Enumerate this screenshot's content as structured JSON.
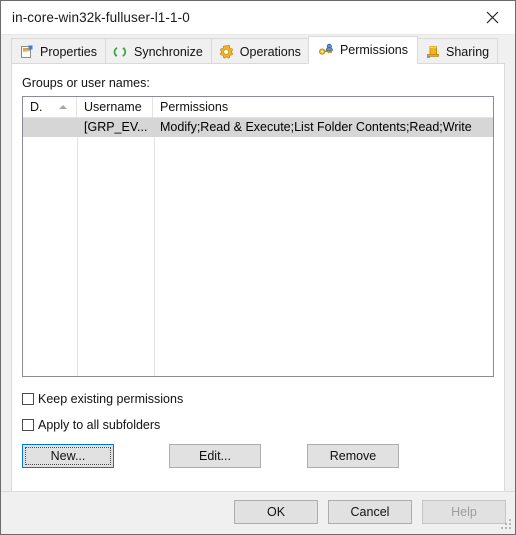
{
  "window": {
    "title": "in-core-win32k-fulluser-l1-1-0",
    "close_icon": "close-icon",
    "resize_grip": "resize-grip"
  },
  "tabs": [
    {
      "label": "Properties",
      "icon": "properties-icon",
      "active": false
    },
    {
      "label": "Synchronize",
      "icon": "synchronize-icon",
      "active": false
    },
    {
      "label": "Operations",
      "icon": "operations-gear-icon",
      "active": false
    },
    {
      "label": "Permissions",
      "icon": "permissions-key-icon",
      "active": true
    },
    {
      "label": "Sharing",
      "icon": "sharing-hand-icon",
      "active": false
    }
  ],
  "main": {
    "groups_label": "Groups or user names:",
    "list": {
      "columns": [
        "D.",
        "Username",
        "Permissions"
      ],
      "sort_column": "D.",
      "sort_direction": "ascending",
      "rows": [
        {
          "domain": "",
          "username": "[GRP_EV...",
          "permissions": "Modify;Read & Execute;List Folder Contents;Read;Write",
          "selected": true
        }
      ]
    },
    "checkboxes": [
      {
        "label": "Keep existing permissions",
        "checked": false
      },
      {
        "label": "Apply to all subfolders",
        "checked": false
      }
    ],
    "actions": [
      {
        "label": "New...",
        "focused": true,
        "enabled": true
      },
      {
        "label": "Edit...",
        "focused": false,
        "enabled": true
      },
      {
        "label": "Remove",
        "focused": false,
        "enabled": true
      }
    ]
  },
  "footer": {
    "buttons": [
      {
        "label": "OK",
        "enabled": true
      },
      {
        "label": "Cancel",
        "enabled": true
      },
      {
        "label": "Help",
        "enabled": false
      }
    ]
  },
  "colors": {
    "accent": "#0078d7",
    "window_bg": "#f0f0f0",
    "panel_bg": "#ffffff",
    "selection": "#d6d6d6",
    "icon_gold": "#f0b429",
    "icon_green": "#3aa33a",
    "icon_blue": "#3e7fd0"
  }
}
